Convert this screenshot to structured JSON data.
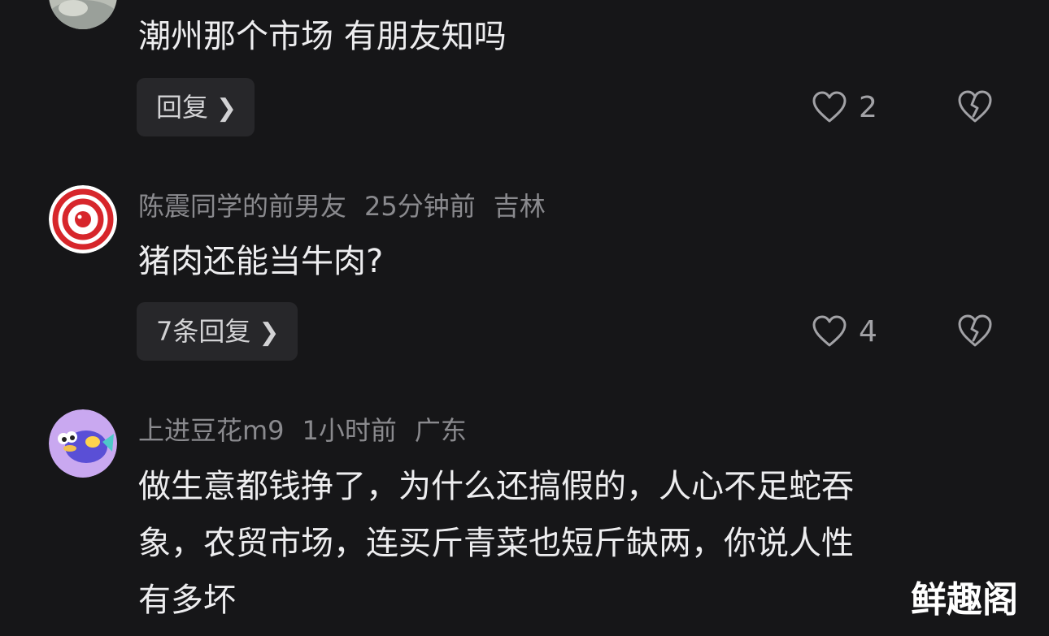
{
  "comments": [
    {
      "text": "潮州那个市场 有朋友知吗",
      "reply_label": "回复",
      "like_count": "2"
    },
    {
      "username": "陈震同学的前男友",
      "time": "25分钟前",
      "location": "吉林",
      "text": "猪肉还能当牛肉?",
      "reply_label": "7条回复",
      "like_count": "4"
    },
    {
      "username": "上进豆花m9",
      "time": "1小时前",
      "location": "广东",
      "text_lines": [
        "做生意都钱挣了，为什么还搞假的，人心不足蛇吞",
        "象，农贸市场，连买斤青菜也短斤缺两，你说人性",
        "有多坏"
      ]
    }
  ],
  "icons": {
    "like": "heart-outline-icon",
    "dislike": "broken-heart-icon",
    "reply_arrow": "chevron-right-icon"
  },
  "colors": {
    "background": "#161618",
    "text_primary": "#ededef",
    "text_secondary": "#8a8a8e",
    "button_bg": "#27272a"
  },
  "watermark": "鲜趣阁"
}
